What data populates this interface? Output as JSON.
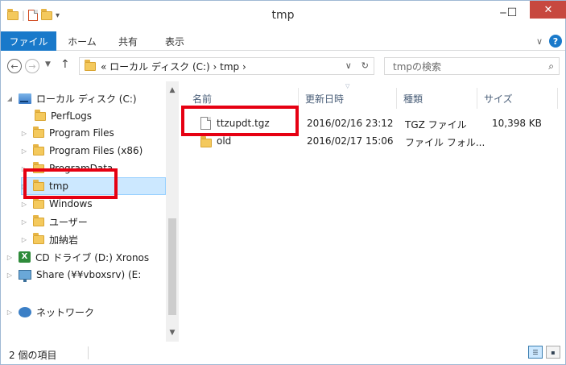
{
  "window": {
    "title": "tmp",
    "minimize_glyph": "‒",
    "maximize_glyph": "☐",
    "close_glyph": "✕"
  },
  "ribbon": {
    "tabs": [
      "ファイル",
      "ホーム",
      "共有",
      "表示"
    ],
    "expand_glyph": "∨",
    "help_glyph": "?"
  },
  "address": {
    "back_glyph": "←",
    "forward_glyph": "→",
    "recent_glyph": "▼",
    "up_glyph": "↑",
    "path": "« ローカル ディスク (C:) › tmp ›",
    "dropdown_glyph": "∨",
    "refresh_glyph": "↻"
  },
  "search": {
    "placeholder": "tmpの検索",
    "icon_glyph": "⌕"
  },
  "nav": {
    "items": [
      {
        "label": "ローカル ディスク (C:)",
        "arrow": "◢"
      },
      {
        "label": "PerfLogs",
        "arrow": ""
      },
      {
        "label": "Program Files",
        "arrow": "▷"
      },
      {
        "label": "Program Files (x86)",
        "arrow": "▷"
      },
      {
        "label": "ProgramData",
        "arrow": "▷"
      },
      {
        "label": "tmp",
        "arrow": "▷"
      },
      {
        "label": "Windows",
        "arrow": "▷"
      },
      {
        "label": "ユーザー",
        "arrow": "▷"
      },
      {
        "label": "加納岩",
        "arrow": "▷"
      },
      {
        "label": "CD ドライブ (D:) Xronos",
        "arrow": "▷"
      },
      {
        "label": "Share (¥¥vboxsrv) (E:",
        "arrow": "▷"
      },
      {
        "label": "ネットワーク",
        "arrow": "▷"
      }
    ],
    "cd_glyph": "X",
    "scroll_up": "▲",
    "scroll_down": "▼"
  },
  "columns": {
    "name": "名前",
    "date": "更新日時",
    "type": "種類",
    "size": "サイズ",
    "sort_glyph": "▽"
  },
  "files": [
    {
      "name": "ttzupdt.tgz",
      "date": "2016/02/16 23:12",
      "type": "TGZ ファイル",
      "size": "10,398 KB"
    },
    {
      "name": "old",
      "date": "2016/02/17 15:06",
      "type": "ファイル フォル...",
      "size": ""
    }
  ],
  "status": {
    "count": "2 個の項目",
    "details_glyph": "☰",
    "tiles_glyph": "▪"
  },
  "colors": {
    "accent": "#1979ca",
    "highlight": "#e60012",
    "selection": "#cce8ff"
  }
}
